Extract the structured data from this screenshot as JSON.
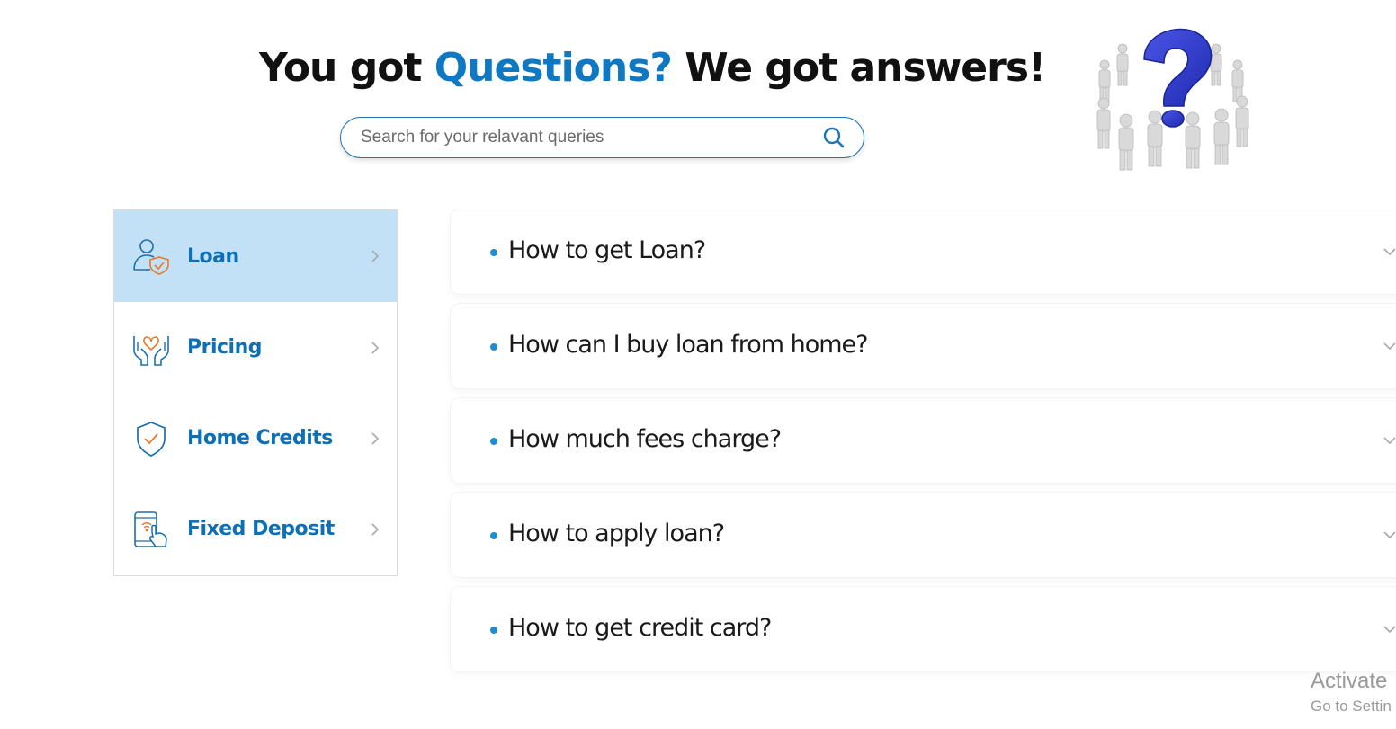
{
  "header": {
    "title_part1": "You got",
    "title_accent": "Questions?",
    "title_part2": "We got answers!",
    "accent_color": "#0f78c2"
  },
  "search": {
    "placeholder": "Search for your relavant queries",
    "icon": "search-icon"
  },
  "illustration": {
    "icon": "question-people-circle-illustration"
  },
  "sidebar": {
    "items": [
      {
        "label": "Loan",
        "icon": "user-shield-icon",
        "active": true
      },
      {
        "label": "Pricing",
        "icon": "hands-heart-icon",
        "active": false
      },
      {
        "label": "Home Credits",
        "icon": "shield-check-icon",
        "active": false
      },
      {
        "label": "Fixed Deposit",
        "icon": "phone-tap-icon",
        "active": false
      }
    ],
    "active_bg": "#c3e1f6",
    "label_color": "#0f6fb5"
  },
  "faq": {
    "items": [
      {
        "question": "How to get Loan?"
      },
      {
        "question": "How can I buy loan from home?"
      },
      {
        "question": "How much fees charge?"
      },
      {
        "question": "How to apply loan?"
      },
      {
        "question": "How to get credit card?"
      }
    ],
    "bullet_color": "#1d8dd3"
  },
  "watermark": {
    "line1": "Activate",
    "line2": "Go to Settin"
  }
}
